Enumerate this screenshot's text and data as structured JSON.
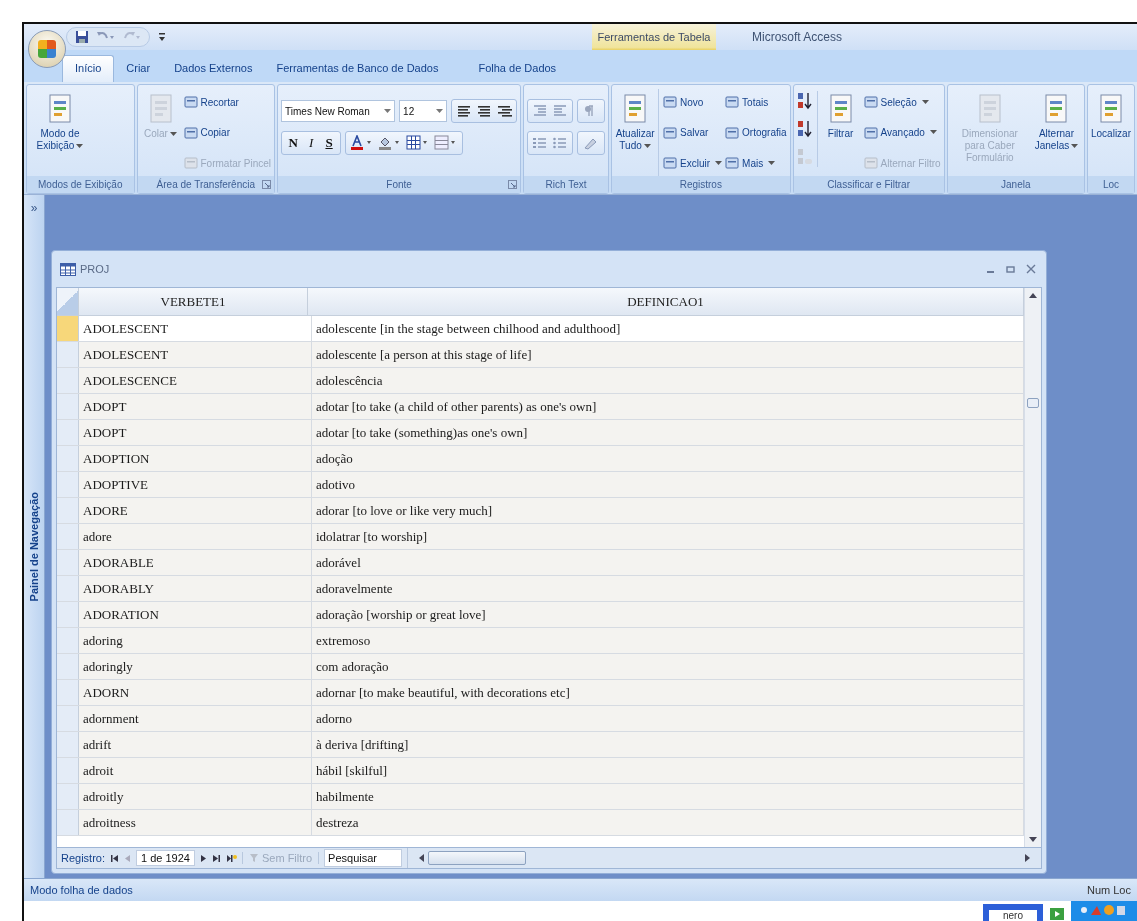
{
  "window": {
    "title": "Microsoft Access",
    "context_tab_group": "Ferramentas de Tabela"
  },
  "tabs": [
    {
      "label": "Início",
      "selected": true
    },
    {
      "label": "Criar",
      "selected": false
    },
    {
      "label": "Dados Externos",
      "selected": false
    },
    {
      "label": "Ferramentas de Banco de Dados",
      "selected": false
    },
    {
      "label": "Folha de Dados",
      "selected": false
    }
  ],
  "ribbon": {
    "groups": [
      {
        "kind": "buttons",
        "label": "Modos de Exibição",
        "launcher": false,
        "columns": [
          [
            {
              "kind": "large",
              "label": "Modo de Exibição",
              "dropdown": true,
              "disabled": false
            }
          ]
        ]
      },
      {
        "kind": "buttons",
        "label": "Área de Transferência",
        "launcher": true,
        "columns": [
          [
            {
              "kind": "large",
              "label": "Colar",
              "dropdown": true,
              "disabled": true
            }
          ],
          [
            {
              "kind": "small",
              "label": "Recortar",
              "dropdown": false,
              "disabled": false
            },
            {
              "kind": "small",
              "label": "Copiar",
              "dropdown": false,
              "disabled": false
            },
            {
              "kind": "small",
              "label": "Formatar Pincel",
              "dropdown": false,
              "disabled": true
            }
          ]
        ]
      },
      {
        "kind": "font",
        "label": "Fonte",
        "launcher": true,
        "font_name": "Times New Roman",
        "font_size": "12",
        "styles": [
          "N",
          "I",
          "S"
        ]
      },
      {
        "kind": "icons",
        "label": "Rich Text",
        "launcher": false
      },
      {
        "kind": "buttons",
        "label": "Registros",
        "launcher": false,
        "columns": [
          [
            {
              "kind": "large",
              "label": "Atualizar Tudo",
              "dropdown": true,
              "disabled": false
            }
          ],
          [
            {
              "kind": "small",
              "label": "Novo",
              "dropdown": false,
              "disabled": false
            },
            {
              "kind": "small",
              "label": "Salvar",
              "dropdown": false,
              "disabled": false
            },
            {
              "kind": "small",
              "label": "Excluir",
              "dropdown": true,
              "disabled": false
            }
          ],
          [
            {
              "kind": "small",
              "label": "Totais",
              "dropdown": false,
              "disabled": false
            },
            {
              "kind": "small",
              "label": "Ortografia",
              "dropdown": false,
              "disabled": false
            },
            {
              "kind": "small",
              "label": "Mais",
              "dropdown": true,
              "disabled": false
            }
          ]
        ]
      },
      {
        "kind": "buttons",
        "label": "Classificar e Filtrar",
        "launcher": false,
        "columns": [
          [
            {
              "kind": "sort"
            }
          ],
          [
            {
              "kind": "large",
              "label": "Filtrar",
              "dropdown": false,
              "disabled": false
            }
          ],
          [
            {
              "kind": "small",
              "label": "Seleção",
              "dropdown": true,
              "disabled": false
            },
            {
              "kind": "small",
              "label": "Avançado",
              "dropdown": true,
              "disabled": false
            },
            {
              "kind": "small",
              "label": "Alternar Filtro",
              "dropdown": false,
              "disabled": true
            }
          ]
        ]
      },
      {
        "kind": "buttons",
        "label": "Janela",
        "launcher": false,
        "columns": [
          [
            {
              "kind": "large",
              "label": "Dimensionar para Caber Formulário",
              "dropdown": false,
              "disabled": true
            }
          ],
          [
            {
              "kind": "large",
              "label": "Alternar Janelas",
              "dropdown": true,
              "disabled": false
            }
          ]
        ]
      },
      {
        "kind": "buttons",
        "label": "Loc",
        "launcher": false,
        "columns": [
          [
            {
              "kind": "large",
              "label": "Localizar",
              "dropdown": false,
              "disabled": false
            }
          ]
        ]
      }
    ]
  },
  "navigation_pane": {
    "title": "Painel de Navegação",
    "toggle": "»"
  },
  "datasheet": {
    "title": "PROJ",
    "columns": [
      "VERBETE1",
      "DEFINICAO1"
    ],
    "rows": [
      {
        "selected": true,
        "cells": [
          "ADOLESCENT",
          "adolescente [in the stage between chilhood and adulthood]"
        ]
      },
      {
        "selected": false,
        "cells": [
          "ADOLESCENT",
          "adolescente [a person at this stage of life]"
        ]
      },
      {
        "selected": false,
        "cells": [
          "ADOLESCENCE",
          "adolescência"
        ]
      },
      {
        "selected": false,
        "cells": [
          "ADOPT",
          "adotar [to take (a child of other parents) as one's own]"
        ]
      },
      {
        "selected": false,
        "cells": [
          "ADOPT",
          "adotar [to take (something)as one's own]"
        ]
      },
      {
        "selected": false,
        "cells": [
          "ADOPTION",
          "adoção"
        ]
      },
      {
        "selected": false,
        "cells": [
          "ADOPTIVE",
          "adotivo"
        ]
      },
      {
        "selected": false,
        "cells": [
          "ADORE",
          "adorar [to love or like very much]"
        ]
      },
      {
        "selected": false,
        "cells": [
          "adore",
          "idolatrar [to worship]"
        ]
      },
      {
        "selected": false,
        "cells": [
          "ADORABLE",
          "adorável"
        ]
      },
      {
        "selected": false,
        "cells": [
          "ADORABLY",
          "adoravelmente"
        ]
      },
      {
        "selected": false,
        "cells": [
          "ADORATION",
          "adoração [worship or great love]"
        ]
      },
      {
        "selected": false,
        "cells": [
          "adoring",
          "extremoso"
        ]
      },
      {
        "selected": false,
        "cells": [
          "adoringly",
          "com adoração"
        ]
      },
      {
        "selected": false,
        "cells": [
          "ADORN",
          "adornar [to make beautiful, with decorations etc]"
        ]
      },
      {
        "selected": false,
        "cells": [
          "adornment",
          "adorno"
        ]
      },
      {
        "selected": false,
        "cells": [
          "adrift",
          "à deriva [drifting]"
        ]
      },
      {
        "selected": false,
        "cells": [
          "adroit",
          "hábil [skilful]"
        ]
      },
      {
        "selected": false,
        "cells": [
          "adroitly",
          "habilmente"
        ]
      },
      {
        "selected": false,
        "cells": [
          "adroitness",
          "destreza"
        ]
      }
    ],
    "record_bar": {
      "label": "Registro:",
      "position": "1 de 1924",
      "filter": "Sem Filtro",
      "filter_disabled": true,
      "search_placeholder": "Pesquisar"
    }
  },
  "status_bar": {
    "mode": "Modo folha de dados",
    "indicator": "Num Loc"
  },
  "taskbar": {
    "app": "nero"
  }
}
